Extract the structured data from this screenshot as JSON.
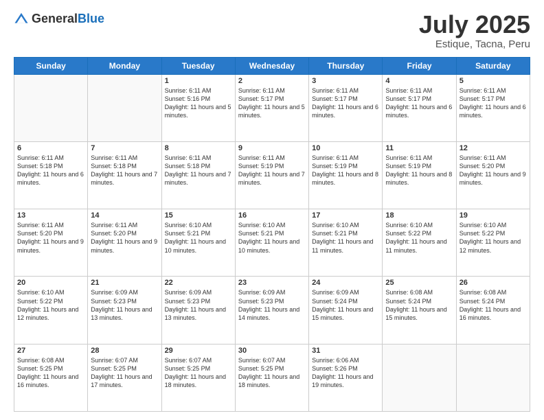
{
  "logo": {
    "general": "General",
    "blue": "Blue"
  },
  "title": {
    "month_year": "July 2025",
    "location": "Estique, Tacna, Peru"
  },
  "weekdays": [
    "Sunday",
    "Monday",
    "Tuesday",
    "Wednesday",
    "Thursday",
    "Friday",
    "Saturday"
  ],
  "weeks": [
    [
      {
        "day": "",
        "info": ""
      },
      {
        "day": "",
        "info": ""
      },
      {
        "day": "1",
        "info": "Sunrise: 6:11 AM\nSunset: 5:16 PM\nDaylight: 11 hours and 5 minutes."
      },
      {
        "day": "2",
        "info": "Sunrise: 6:11 AM\nSunset: 5:17 PM\nDaylight: 11 hours and 5 minutes."
      },
      {
        "day": "3",
        "info": "Sunrise: 6:11 AM\nSunset: 5:17 PM\nDaylight: 11 hours and 6 minutes."
      },
      {
        "day": "4",
        "info": "Sunrise: 6:11 AM\nSunset: 5:17 PM\nDaylight: 11 hours and 6 minutes."
      },
      {
        "day": "5",
        "info": "Sunrise: 6:11 AM\nSunset: 5:17 PM\nDaylight: 11 hours and 6 minutes."
      }
    ],
    [
      {
        "day": "6",
        "info": "Sunrise: 6:11 AM\nSunset: 5:18 PM\nDaylight: 11 hours and 6 minutes."
      },
      {
        "day": "7",
        "info": "Sunrise: 6:11 AM\nSunset: 5:18 PM\nDaylight: 11 hours and 7 minutes."
      },
      {
        "day": "8",
        "info": "Sunrise: 6:11 AM\nSunset: 5:18 PM\nDaylight: 11 hours and 7 minutes."
      },
      {
        "day": "9",
        "info": "Sunrise: 6:11 AM\nSunset: 5:19 PM\nDaylight: 11 hours and 7 minutes."
      },
      {
        "day": "10",
        "info": "Sunrise: 6:11 AM\nSunset: 5:19 PM\nDaylight: 11 hours and 8 minutes."
      },
      {
        "day": "11",
        "info": "Sunrise: 6:11 AM\nSunset: 5:19 PM\nDaylight: 11 hours and 8 minutes."
      },
      {
        "day": "12",
        "info": "Sunrise: 6:11 AM\nSunset: 5:20 PM\nDaylight: 11 hours and 9 minutes."
      }
    ],
    [
      {
        "day": "13",
        "info": "Sunrise: 6:11 AM\nSunset: 5:20 PM\nDaylight: 11 hours and 9 minutes."
      },
      {
        "day": "14",
        "info": "Sunrise: 6:11 AM\nSunset: 5:20 PM\nDaylight: 11 hours and 9 minutes."
      },
      {
        "day": "15",
        "info": "Sunrise: 6:10 AM\nSunset: 5:21 PM\nDaylight: 11 hours and 10 minutes."
      },
      {
        "day": "16",
        "info": "Sunrise: 6:10 AM\nSunset: 5:21 PM\nDaylight: 11 hours and 10 minutes."
      },
      {
        "day": "17",
        "info": "Sunrise: 6:10 AM\nSunset: 5:21 PM\nDaylight: 11 hours and 11 minutes."
      },
      {
        "day": "18",
        "info": "Sunrise: 6:10 AM\nSunset: 5:22 PM\nDaylight: 11 hours and 11 minutes."
      },
      {
        "day": "19",
        "info": "Sunrise: 6:10 AM\nSunset: 5:22 PM\nDaylight: 11 hours and 12 minutes."
      }
    ],
    [
      {
        "day": "20",
        "info": "Sunrise: 6:10 AM\nSunset: 5:22 PM\nDaylight: 11 hours and 12 minutes."
      },
      {
        "day": "21",
        "info": "Sunrise: 6:09 AM\nSunset: 5:23 PM\nDaylight: 11 hours and 13 minutes."
      },
      {
        "day": "22",
        "info": "Sunrise: 6:09 AM\nSunset: 5:23 PM\nDaylight: 11 hours and 13 minutes."
      },
      {
        "day": "23",
        "info": "Sunrise: 6:09 AM\nSunset: 5:23 PM\nDaylight: 11 hours and 14 minutes."
      },
      {
        "day": "24",
        "info": "Sunrise: 6:09 AM\nSunset: 5:24 PM\nDaylight: 11 hours and 15 minutes."
      },
      {
        "day": "25",
        "info": "Sunrise: 6:08 AM\nSunset: 5:24 PM\nDaylight: 11 hours and 15 minutes."
      },
      {
        "day": "26",
        "info": "Sunrise: 6:08 AM\nSunset: 5:24 PM\nDaylight: 11 hours and 16 minutes."
      }
    ],
    [
      {
        "day": "27",
        "info": "Sunrise: 6:08 AM\nSunset: 5:25 PM\nDaylight: 11 hours and 16 minutes."
      },
      {
        "day": "28",
        "info": "Sunrise: 6:07 AM\nSunset: 5:25 PM\nDaylight: 11 hours and 17 minutes."
      },
      {
        "day": "29",
        "info": "Sunrise: 6:07 AM\nSunset: 5:25 PM\nDaylight: 11 hours and 18 minutes."
      },
      {
        "day": "30",
        "info": "Sunrise: 6:07 AM\nSunset: 5:25 PM\nDaylight: 11 hours and 18 minutes."
      },
      {
        "day": "31",
        "info": "Sunrise: 6:06 AM\nSunset: 5:26 PM\nDaylight: 11 hours and 19 minutes."
      },
      {
        "day": "",
        "info": ""
      },
      {
        "day": "",
        "info": ""
      }
    ]
  ]
}
